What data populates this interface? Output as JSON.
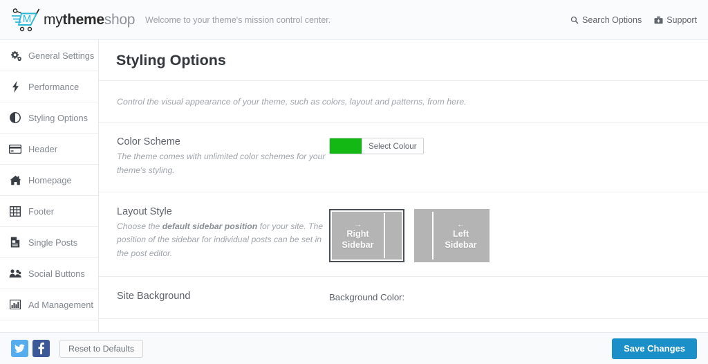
{
  "header": {
    "logo_my": "my",
    "logo_theme": "theme",
    "logo_shop": "shop",
    "logo_cart_letter": "M",
    "welcome": "Welcome to your theme's mission control center.",
    "search_label": "Search Options",
    "support_label": "Support",
    "brand_color": "#29b6d8",
    "background": "#fafbfc"
  },
  "sidebar": {
    "items": [
      {
        "label": "General Settings",
        "icon": "gears-icon",
        "active": false
      },
      {
        "label": "Performance",
        "icon": "bolt-icon",
        "active": false
      },
      {
        "label": "Styling Options",
        "icon": "adjust-icon",
        "active": true
      },
      {
        "label": "Header",
        "icon": "credit-card-icon",
        "active": false
      },
      {
        "label": "Homepage",
        "icon": "home-icon",
        "active": false
      },
      {
        "label": "Footer",
        "icon": "table-icon",
        "active": false
      },
      {
        "label": "Single Posts",
        "icon": "file-text-icon",
        "active": false
      },
      {
        "label": "Social Buttons",
        "icon": "group-icon",
        "active": false
      },
      {
        "label": "Ad Management",
        "icon": "bar-chart-icon",
        "active": false
      }
    ]
  },
  "main": {
    "title": "Styling Options",
    "description": "Control the visual appearance of your theme, such as colors, layout and patterns, from here.",
    "color_scheme": {
      "name": "Color Scheme",
      "help": "The theme comes with unlimited color schemes for your theme's styling.",
      "swatch_color": "#14b814",
      "button_label": "Select Colour"
    },
    "layout_style": {
      "name": "Layout Style",
      "help_part1": "Choose the ",
      "help_bold": "default sidebar position",
      "help_part2": " for your site. The position of the sidebar for individual posts can be set in the post editor.",
      "options": [
        {
          "line1": "Right",
          "line2": "Sidebar",
          "arrow": "→",
          "selected": true
        },
        {
          "line1": "Left",
          "line2": "Sidebar",
          "arrow": "←",
          "selected": false
        }
      ]
    },
    "site_background": {
      "name": "Site Background",
      "field_label": "Background Color:"
    }
  },
  "footer": {
    "twitter_icon": "twitter-icon",
    "facebook_icon": "facebook-icon",
    "reset_label": "Reset to Defaults",
    "save_label": "Save Changes",
    "save_color": "#1b8fc7"
  }
}
